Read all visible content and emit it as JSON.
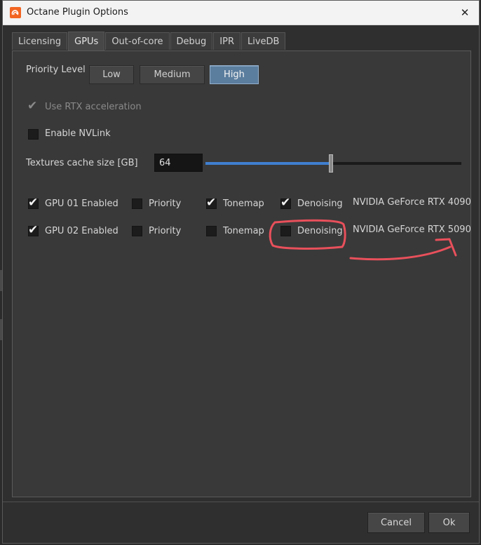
{
  "window": {
    "title": "Octane Plugin Options",
    "close_glyph": "✕"
  },
  "tabs": [
    {
      "label": "Licensing",
      "active": false
    },
    {
      "label": "GPUs",
      "active": true
    },
    {
      "label": "Out-of-core",
      "active": false
    },
    {
      "label": "Debug",
      "active": false
    },
    {
      "label": "IPR",
      "active": false
    },
    {
      "label": "LiveDB",
      "active": false
    }
  ],
  "priority": {
    "label": "Priority Level",
    "options": [
      "Low",
      "Medium",
      "High"
    ],
    "selected": "High"
  },
  "rtx": {
    "label": "Use RTX acceleration",
    "checked": true,
    "enabled": false
  },
  "nvlink": {
    "label": "Enable NVLink",
    "checked": false
  },
  "texture_cache": {
    "label": "Textures cache size [GB]",
    "value": "64",
    "slider_fraction": 0.49
  },
  "gpus": [
    {
      "enabled_label": "GPU 01 Enabled",
      "enabled": true,
      "priority_label": "Priority",
      "priority": false,
      "tonemap_label": "Tonemap",
      "tonemap": true,
      "denoising_label": "Denoising",
      "denoising": true,
      "device": "NVIDIA GeForce RTX 4090"
    },
    {
      "enabled_label": "GPU 02 Enabled",
      "enabled": true,
      "priority_label": "Priority",
      "priority": false,
      "tonemap_label": "Tonemap",
      "tonemap": false,
      "denoising_label": "Denoising",
      "denoising": false,
      "device": "NVIDIA GeForce RTX 5090"
    }
  ],
  "footer": {
    "cancel_label": "Cancel",
    "ok_label": "Ok"
  },
  "colors": {
    "accent": "#5b7d9e",
    "slider_fill": "#3f7fcf",
    "annotation": "#e8505b"
  },
  "check_glyph": "✔"
}
